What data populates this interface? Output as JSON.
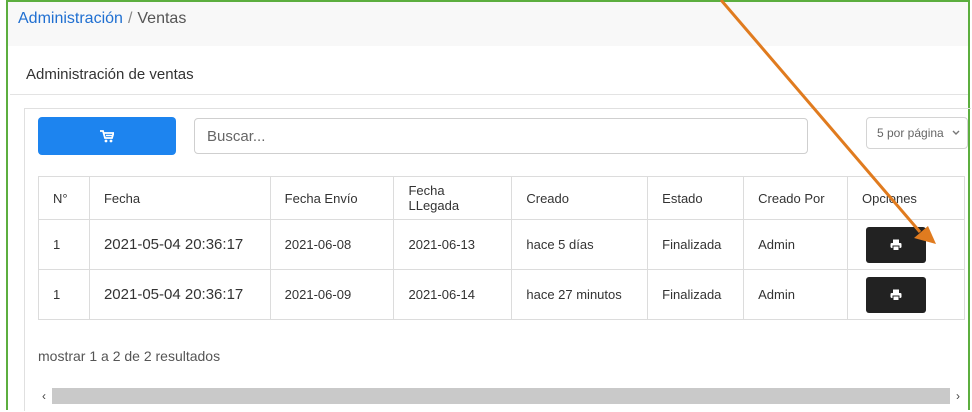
{
  "breadcrumb": {
    "parent": "Administración",
    "separator": "/",
    "current": "Ventas"
  },
  "card": {
    "title": "Administración de ventas"
  },
  "toolbar": {
    "cart_icon": "cart-icon",
    "search_placeholder": "Buscar...",
    "per_page": "5 por página"
  },
  "table": {
    "headers": [
      "N°",
      "Fecha",
      "Fecha Envío",
      "Fecha LLegada",
      "Creado",
      "Estado",
      "Creado Por",
      "Opciones"
    ],
    "rows": [
      {
        "n": "1",
        "fecha": "2021-05-04 20:36:17",
        "envio": "2021-06-08",
        "llegada": "2021-06-13",
        "creado": "hace 5 días",
        "estado": "Finalizada",
        "creado_por": "Admin"
      },
      {
        "n": "1",
        "fecha": "2021-05-04 20:36:17",
        "envio": "2021-06-09",
        "llegada": "2021-06-14",
        "creado": "hace 27 minutos",
        "estado": "Finalizada",
        "creado_por": "Admin"
      }
    ]
  },
  "summary": "mostrar 1 a 2 de 2 resultados",
  "colors": {
    "primary": "#1d84ef",
    "dark_button": "#222222",
    "annotation_arrow": "#e07b1f",
    "frame": "#5cae3f"
  }
}
